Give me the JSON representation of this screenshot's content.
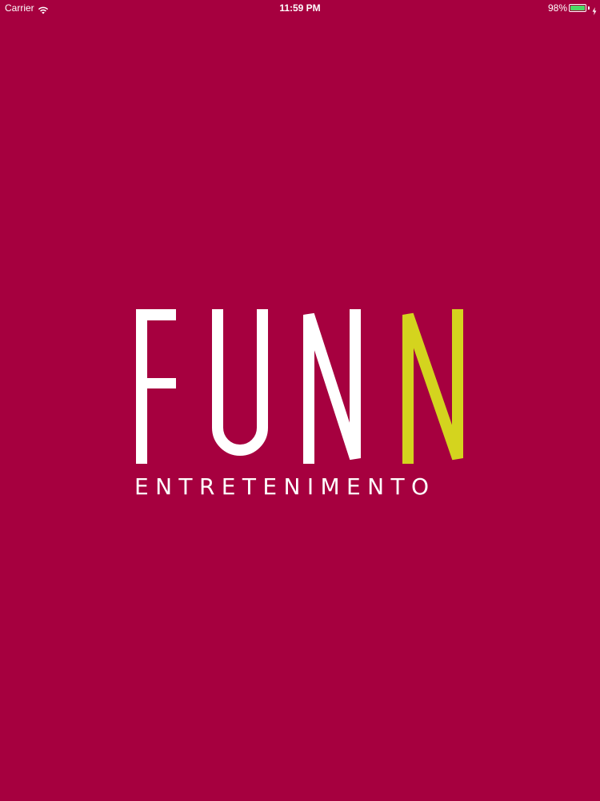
{
  "status_bar": {
    "carrier": "Carrier",
    "time": "11:59 PM",
    "battery_percent": "98%",
    "battery_level": 0.98,
    "battery_color": "#4cd964"
  },
  "splash": {
    "background_color": "#a6003f",
    "logo": {
      "wordmark": "FUNN",
      "accent_letter_color": "#d4d41e",
      "tagline": "ENTRETENIMENTO"
    }
  }
}
